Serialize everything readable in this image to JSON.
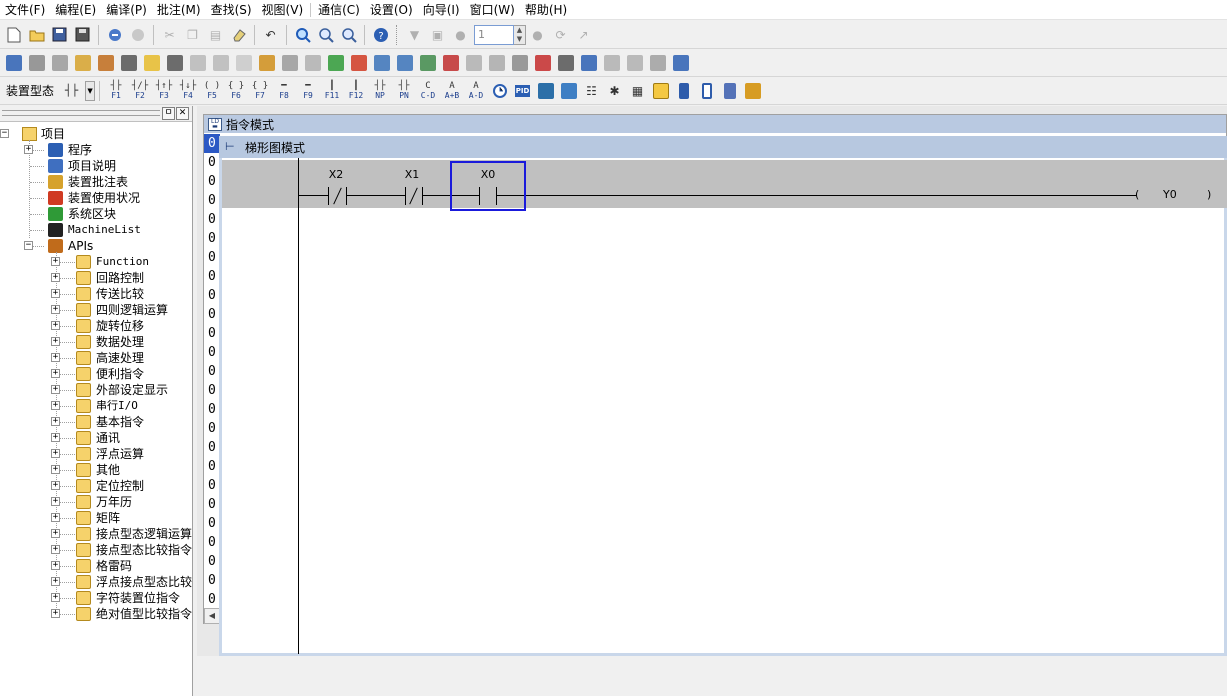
{
  "menu": [
    "文件(F)",
    "编程(E)",
    "编译(P)",
    "批注(M)",
    "查找(S)",
    "视图(V)",
    "通信(C)",
    "设置(O)",
    "向导(I)",
    "窗口(W)",
    "帮助(H)"
  ],
  "toolbar1": {
    "step_value": "1"
  },
  "toolbar3": {
    "device_mode_label": "装置型态",
    "fkeys": [
      {
        "sym": "┤├",
        "key": "F1"
      },
      {
        "sym": "┤/├",
        "key": "F2"
      },
      {
        "sym": "┤↑├",
        "key": "F3"
      },
      {
        "sym": "┤↓├",
        "key": "F4"
      },
      {
        "sym": "( )",
        "key": "F5"
      },
      {
        "sym": "{ }",
        "key": "F6"
      },
      {
        "sym": "{ }",
        "key": "F7"
      },
      {
        "sym": "━",
        "key": "F8"
      },
      {
        "sym": "━",
        "key": "F9"
      },
      {
        "sym": "┃",
        "key": "F11"
      },
      {
        "sym": "┃",
        "key": "F12"
      },
      {
        "sym": "┤├",
        "key": "NP"
      },
      {
        "sym": "┤├",
        "key": "PN"
      },
      {
        "sym": "C",
        "key": "C-D"
      },
      {
        "sym": "A",
        "key": "A+B"
      },
      {
        "sym": "A",
        "key": "A-D"
      }
    ],
    "pid_label": "PID"
  },
  "project_panel": {
    "pin_glyph": "ㅁ",
    "close_glyph": "✕",
    "root": "项目",
    "children": [
      "程序",
      "项目说明",
      "装置批注表",
      "装置使用状况",
      "系统区块",
      "MachineList",
      "APIs"
    ],
    "api_children": [
      "Function",
      "回路控制",
      "传送比较",
      "四则逻辑运算",
      "旋转位移",
      "数据处理",
      "高速处理",
      "便利指令",
      "外部设定显示",
      "串行I/O",
      "基本指令",
      "通讯",
      "浮点运算",
      "其他",
      "定位控制",
      "万年历",
      "矩阵",
      "接点型态逻辑运算",
      "接点型态比较指令",
      "格雷码",
      "浮点接点型态比较",
      "字符装置位指令",
      "绝对值型比较指令"
    ]
  },
  "instruction_window": {
    "title": "指令模式",
    "row_digit": "0",
    "row_count": 25
  },
  "ladder_window": {
    "title": "梯形图模式",
    "contacts": [
      {
        "label": "X2",
        "type": "normally-closed"
      },
      {
        "label": "X1",
        "type": "normally-closed"
      },
      {
        "label": "X0",
        "type": "normally-open",
        "selected": true
      }
    ],
    "coil": {
      "open": "(",
      "label": "Y0",
      "close": ")"
    }
  },
  "colors": {
    "selection_blue": "#1a1adb",
    "row_highlight": "#2b58c4",
    "title_bar": "#b7c8e0",
    "rung_background": "#c0c0c0"
  }
}
